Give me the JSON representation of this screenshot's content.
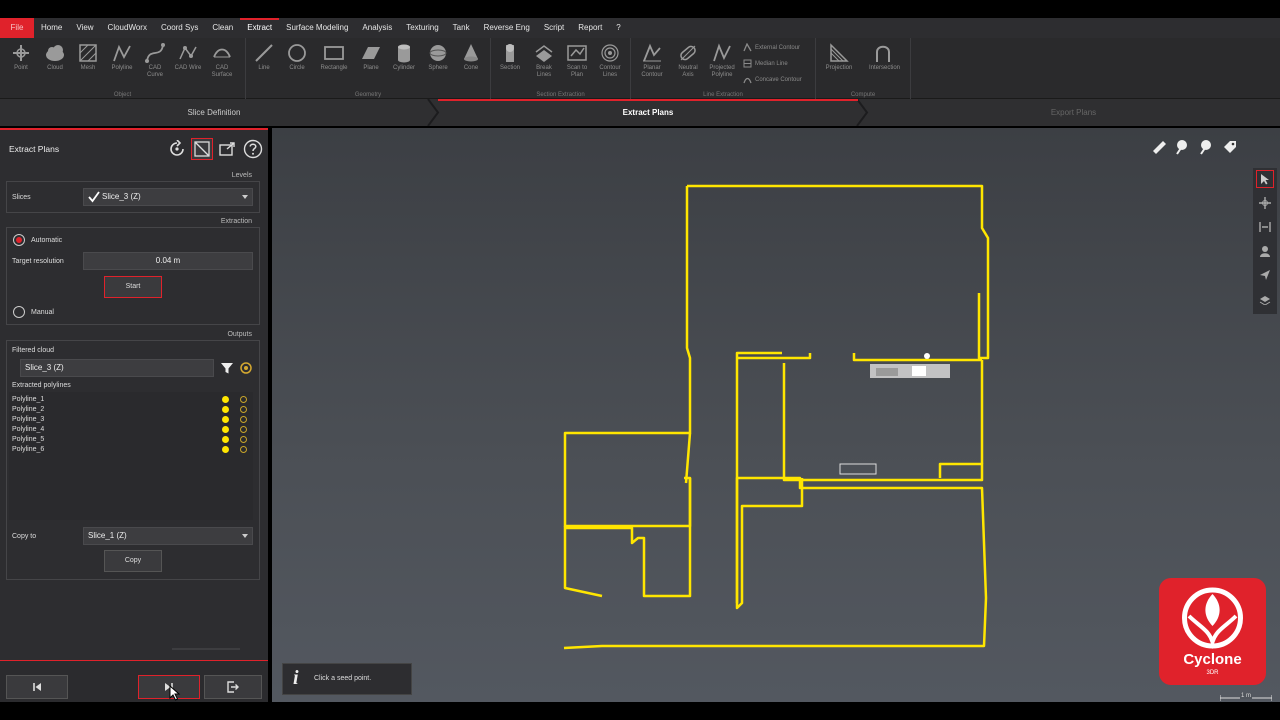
{
  "menu": {
    "items": [
      "File",
      "Home",
      "View",
      "CloudWorx",
      "Coord Sys",
      "Clean",
      "Extract",
      "Surface Modeling",
      "Analysis",
      "Texturing",
      "Tank",
      "Reverse Eng",
      "Script",
      "Report",
      "?"
    ],
    "active": "Extract"
  },
  "ribbon": {
    "groups": [
      {
        "label": "Object",
        "tools": [
          "Point",
          "Cloud",
          "Mesh",
          "Polyline",
          "CAD Curve",
          "CAD Wire",
          "CAD Surface"
        ]
      },
      {
        "label": "Geometry",
        "tools": [
          "Line",
          "Circle",
          "Rectangle",
          "Plane",
          "Cylinder",
          "Sphere",
          "Cone"
        ]
      },
      {
        "label": "Section Extraction",
        "tools": [
          "Section",
          "Break Lines",
          "Scan to Plan",
          "Contour Lines"
        ]
      },
      {
        "label": "Line Extraction",
        "tools": [
          "Planar Contour",
          "Neutral Axis",
          "Projected Polyline"
        ],
        "small": [
          "External Contour",
          "Median Line",
          "Concave Contour"
        ]
      },
      {
        "label": "Compute",
        "tools": [
          "Projection",
          "Intersection"
        ]
      }
    ]
  },
  "steps": [
    {
      "label": "Slice Definition",
      "state": "done"
    },
    {
      "label": "Extract Plans",
      "state": "active"
    },
    {
      "label": "Export Plans",
      "state": "disabled"
    }
  ],
  "panel": {
    "title": "Extract Plans",
    "levels_label": "Levels",
    "slices_label": "Slices",
    "slices_value": "Slice_3 (Z)",
    "extraction_label": "Extraction",
    "automatic_label": "Automatic",
    "target_resolution_label": "Target resolution",
    "target_resolution_value": "0.04 m",
    "start_label": "Start",
    "manual_label": "Manual",
    "outputs_label": "Outputs",
    "filtered_cloud_label": "Filtered cloud",
    "filtered_cloud_value": "Slice_3 (Z)",
    "extracted_polylines_label": "Extracted polylines",
    "polylines": [
      "Polyline_1",
      "Polyline_2",
      "Polyline_3",
      "Polyline_4",
      "Polyline_5",
      "Polyline_6"
    ],
    "copy_to_label": "Copy to",
    "copy_to_value": "Slice_1 (Z)",
    "copy_label": "Copy"
  },
  "info": {
    "icon": "i",
    "text": "Click a seed point."
  },
  "logo": {
    "name": "Cyclone",
    "sub": "3DR"
  },
  "scale": {
    "text": "1 m"
  },
  "colors": {
    "accent": "#e0222b",
    "polyline": "#ffe600",
    "panel": "#2d2d30",
    "viewport": "#4a4e54"
  }
}
